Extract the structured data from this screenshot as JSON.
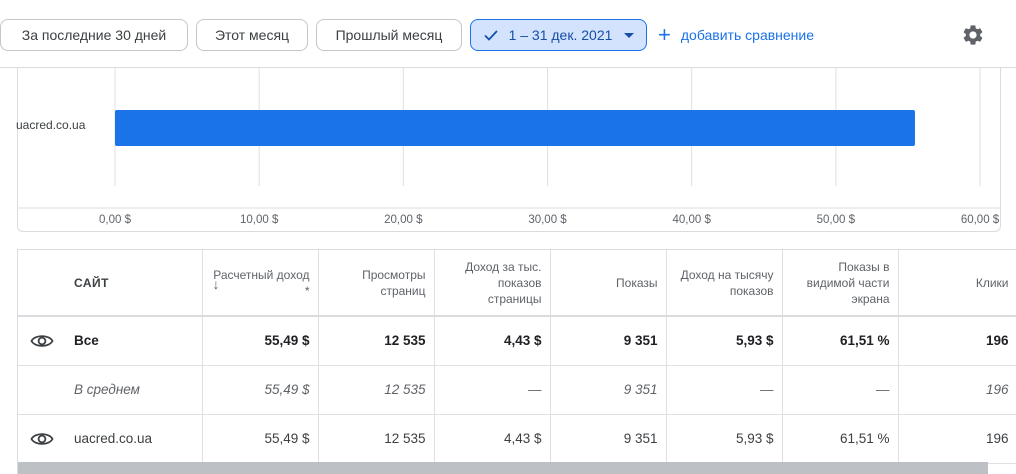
{
  "filters": {
    "last30": "За последние 30 дней",
    "this_month": "Этот месяц",
    "last_month": "Прошлый месяц",
    "selected_range": "1 – 31 дек. 2021",
    "add_compare": "добавить сравнение"
  },
  "chart_data": {
    "type": "bar",
    "orientation": "horizontal",
    "categories": [
      "uacred.co.ua"
    ],
    "values": [
      55.49
    ],
    "xlim": [
      0,
      60
    ],
    "xticks": [
      "0,00 $",
      "10,00 $",
      "20,00 $",
      "30,00 $",
      "40,00 $",
      "50,00 $",
      "60,00 $"
    ],
    "bar_color": "#1a73e8",
    "grid": true
  },
  "table": {
    "headers": {
      "site": "САЙТ",
      "revenue": "Расчетный доход *",
      "pageviews": "Просмотры страниц",
      "page_rpm": "Доход за тыс. показов страницы",
      "impressions": "Показы",
      "rpm": "Доход на тысячу показов",
      "viewable": "Показы в видимой части экрана",
      "clicks": "Клики"
    },
    "rows": {
      "all": {
        "site": "Все",
        "revenue": "55,49 $",
        "pageviews": "12 535",
        "page_rpm": "4,43 $",
        "impressions": "9 351",
        "rpm": "5,93 $",
        "viewable": "61,51 %",
        "clicks": "196"
      },
      "avg": {
        "site": "В среднем",
        "revenue": "55,49 $",
        "pageviews": "12 535",
        "page_rpm": "—",
        "impressions": "9 351",
        "rpm": "—",
        "viewable": "—",
        "clicks": "196"
      },
      "site": {
        "site": "uacred.co.ua",
        "revenue": "55,49 $",
        "pageviews": "12 535",
        "page_rpm": "4,43 $",
        "impressions": "9 351",
        "rpm": "5,93 $",
        "viewable": "61,51 %",
        "clicks": "196"
      }
    }
  },
  "icons": {
    "check": "check-icon",
    "caret": "dropdown-caret-icon",
    "plus": "plus-icon",
    "gear": "gear-icon",
    "eye": "eye-icon",
    "sort": "sort-down-icon"
  }
}
